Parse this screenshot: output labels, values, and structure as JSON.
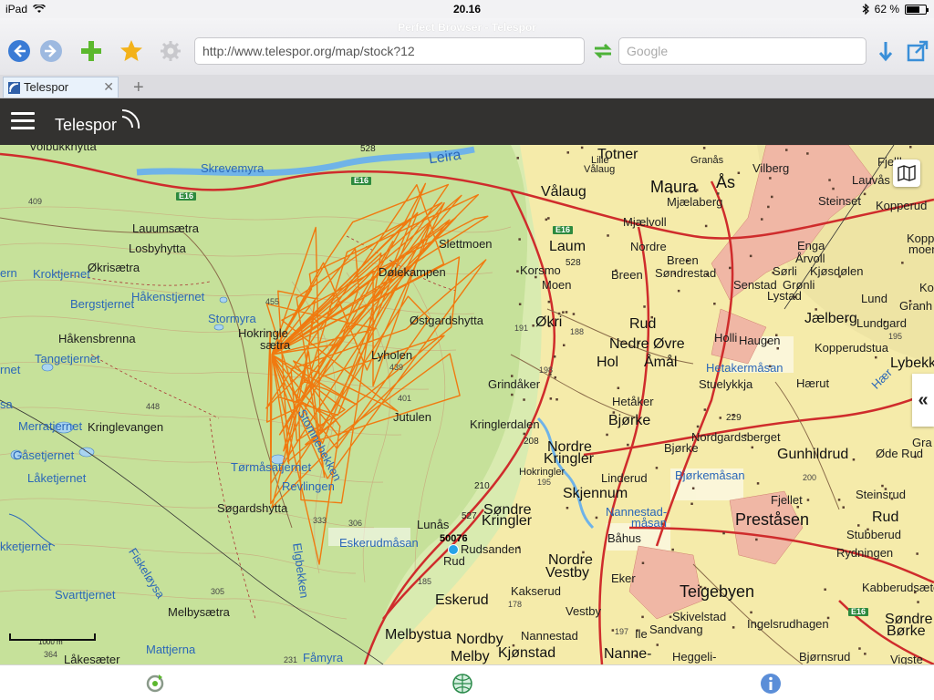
{
  "status": {
    "device": "iPad",
    "time": "20.16",
    "battery": "62 %",
    "battery_level": 0.62
  },
  "browser": {
    "window_title": "Perfect Browser - Telespor",
    "url": "http://www.telespor.org/map/stock?12",
    "search_placeholder": "Google",
    "tab_title": "Telespor",
    "tab_close": "✕",
    "new_tab": "+"
  },
  "app": {
    "brand": "Telespor",
    "side_toggle": "«"
  },
  "map": {
    "scale": "1000 m",
    "tracker_id": "50076",
    "roads": {
      "e16_a": "E16",
      "e16_b": "E16",
      "e16_c": "E16",
      "e16_d": "E16"
    },
    "places": {
      "maura": "Maura",
      "as": "Ås",
      "valaug": "Vålaug",
      "laum": "Laum",
      "okri": "Økri",
      "rud": "Rud",
      "nedre_ovre": "Nedre Øvre",
      "hol": "Hol",
      "amal": "Åmål",
      "bjorke": "Bjørke",
      "bjorke2": "Bjørke",
      "nordre_kringler": "Nordre",
      "nordre_kringler2": "Kringler",
      "sondre_kringler": "Søndre",
      "sondre_kringler2": "Kringler",
      "skjennum": "Skjennum",
      "nordre_vestby": "Nordre",
      "nordre_vestby2": "Vestby",
      "eskerud": "Eskerud",
      "melbystua": "Melbystua",
      "nordby": "Nordby",
      "melby": "Melby",
      "kjonstad": "Kjønstad",
      "teigebyen": "Teigebyen",
      "prestasen": "Preståsen",
      "gunhildrud": "Gunhildrud",
      "jaelberg": "Jælberg",
      "totner": "Totner",
      "dolekampen": "Dølekampen",
      "lyholen": "Lyholen",
      "jutulen": "Jutulen",
      "slettmoen": "Slettmoen",
      "ostgardshytta": "Østgardshytta",
      "hakensbrenna": "Håkensbrenna",
      "hokringle": "Hokringle",
      "saetra": "sætra",
      "lauumsaetra": "Lauumsætra",
      "losbyhytta": "Losbyhytta",
      "okrisaetra": "Økrisætra",
      "kringlevangen": "Kringlevangen",
      "sogardshytta": "Søgardshytta",
      "melbysaetra": "Melbysætra",
      "grindaker": "Grindåker",
      "kringlerdalen": "Kringlerdalen",
      "hokringler": "Hokringler",
      "linderud": "Linderud",
      "nordgardsberget": "Nordgardsberget",
      "fjellet": "Fjellet",
      "steinsrud": "Steinsrud",
      "stubberud": "Stubberud",
      "rydningen": "Rydningen",
      "kabberudsaeter": "Kabberudsæter",
      "sondre_borke": "Søndre",
      "sondre_borke2": "Børke",
      "vilberg": "Vilberg",
      "steinset": "Steinset",
      "kopperud": "Kopperud",
      "lund": "Lund",
      "lundgard": "Lundgard",
      "kopperudstua": "Kopperudstua",
      "holli": "Holli",
      "haugen": "Haugen",
      "haerut": "Hærut",
      "stuelykkja": "Stuelykkja",
      "hetaker": "Hetåker",
      "mjaelaberg": "Mjælaberg",
      "mjaelvoll": "Mjælvoll",
      "nordre": "Nordre",
      "breen": "Breen",
      "breen2": "Breen",
      "sondrestad": "Søndrestad",
      "korsmo": "Korsmo",
      "moen": "Moen",
      "enga": "Enga",
      "arvoll": "Årvoll",
      "sorli": "Sørli",
      "kjosdolen": "Kjøsdølen",
      "senstad": "Senstad",
      "gronli": "Grønli",
      "lystad": "Lystad",
      "lunas": "Lunås",
      "rudsanden": "Rudsanden",
      "rud2": "Rud",
      "bahus": "Båhus",
      "kakserud": "Kakserud",
      "eker": "Eker",
      "vestby": "Vestby",
      "nannestad": "Nannestad",
      "ile": "Ile",
      "skivelstad": "Skivelstad",
      "sandvang": "Sandvang",
      "ingelsrudhagen": "Ingelsrudhagen",
      "nanne": "Nanne-",
      "heggeli": "Heggeli-",
      "bjornsrud": "Bjørnsrud",
      "vigste": "Vigste",
      "ode_rud": "Øde Rud",
      "rud3": "Rud",
      "lakesaeter": "Låkesæter",
      "granas": "Granås",
      "lauvas": "Lauvås",
      "fjellhau": "Fjellhau",
      "lille": "Lille",
      "valaug2": "Vålaug",
      "lybekk": "Lybekk",
      "gra": "Gra",
      "grant": "Granh",
      "kopperud2": "Kopperu",
      "moen2": "moen",
      "ko": "Ko",
      "volbuk": "Volbukkhytta"
    },
    "waters": {
      "leira": "Leira",
      "skrevemyra": "Skrevemyra",
      "kroktjernet": "Kroktjernet",
      "bergstjernet": "Bergstjernet",
      "hakenstjernet": "Håkenstjernet",
      "stormyra": "Stormyra",
      "tangetjernet": "Tangetjernet",
      "merratjernet": "Merratjernet",
      "gasetjernet": "Gåsetjernet",
      "laketjernet": "Låketjernet",
      "tormasatjernet": "Tørmåsatjernet",
      "revlingen": "Revlingen",
      "stomnebekken": "Stomnebekken",
      "eskerudmasan": "Eskerudmåsan",
      "elgbekken": "Elgbekken",
      "fiskeloysa": "Fiskeløysa",
      "svarttjernet": "Svarttjernet",
      "mattjerna": "Mattjerna",
      "famyra": "Fåmyra",
      "hetakermasan": "Hetakermåsan",
      "bjorkemasan": "Bjørkemåsan",
      "nannestad_masan": "Nannestad-",
      "nannestad_masan2": "måsan",
      "ketjernet": "kketjernet",
      "ern": "ern",
      "rnet": "rnet",
      "sa": "sa",
      "haer": "Hær"
    },
    "heights": [
      "455",
      "439",
      "401",
      "448",
      "409",
      "333",
      "306",
      "305",
      "231",
      "185",
      "178",
      "195",
      "191",
      "198",
      "188",
      "200",
      "197",
      "210",
      "208",
      "229",
      "195",
      "364",
      "364",
      "528",
      "527",
      "528"
    ]
  },
  "bottom": {
    "reload": "reload-icon",
    "globe": "globe-icon",
    "info": "info-icon"
  }
}
